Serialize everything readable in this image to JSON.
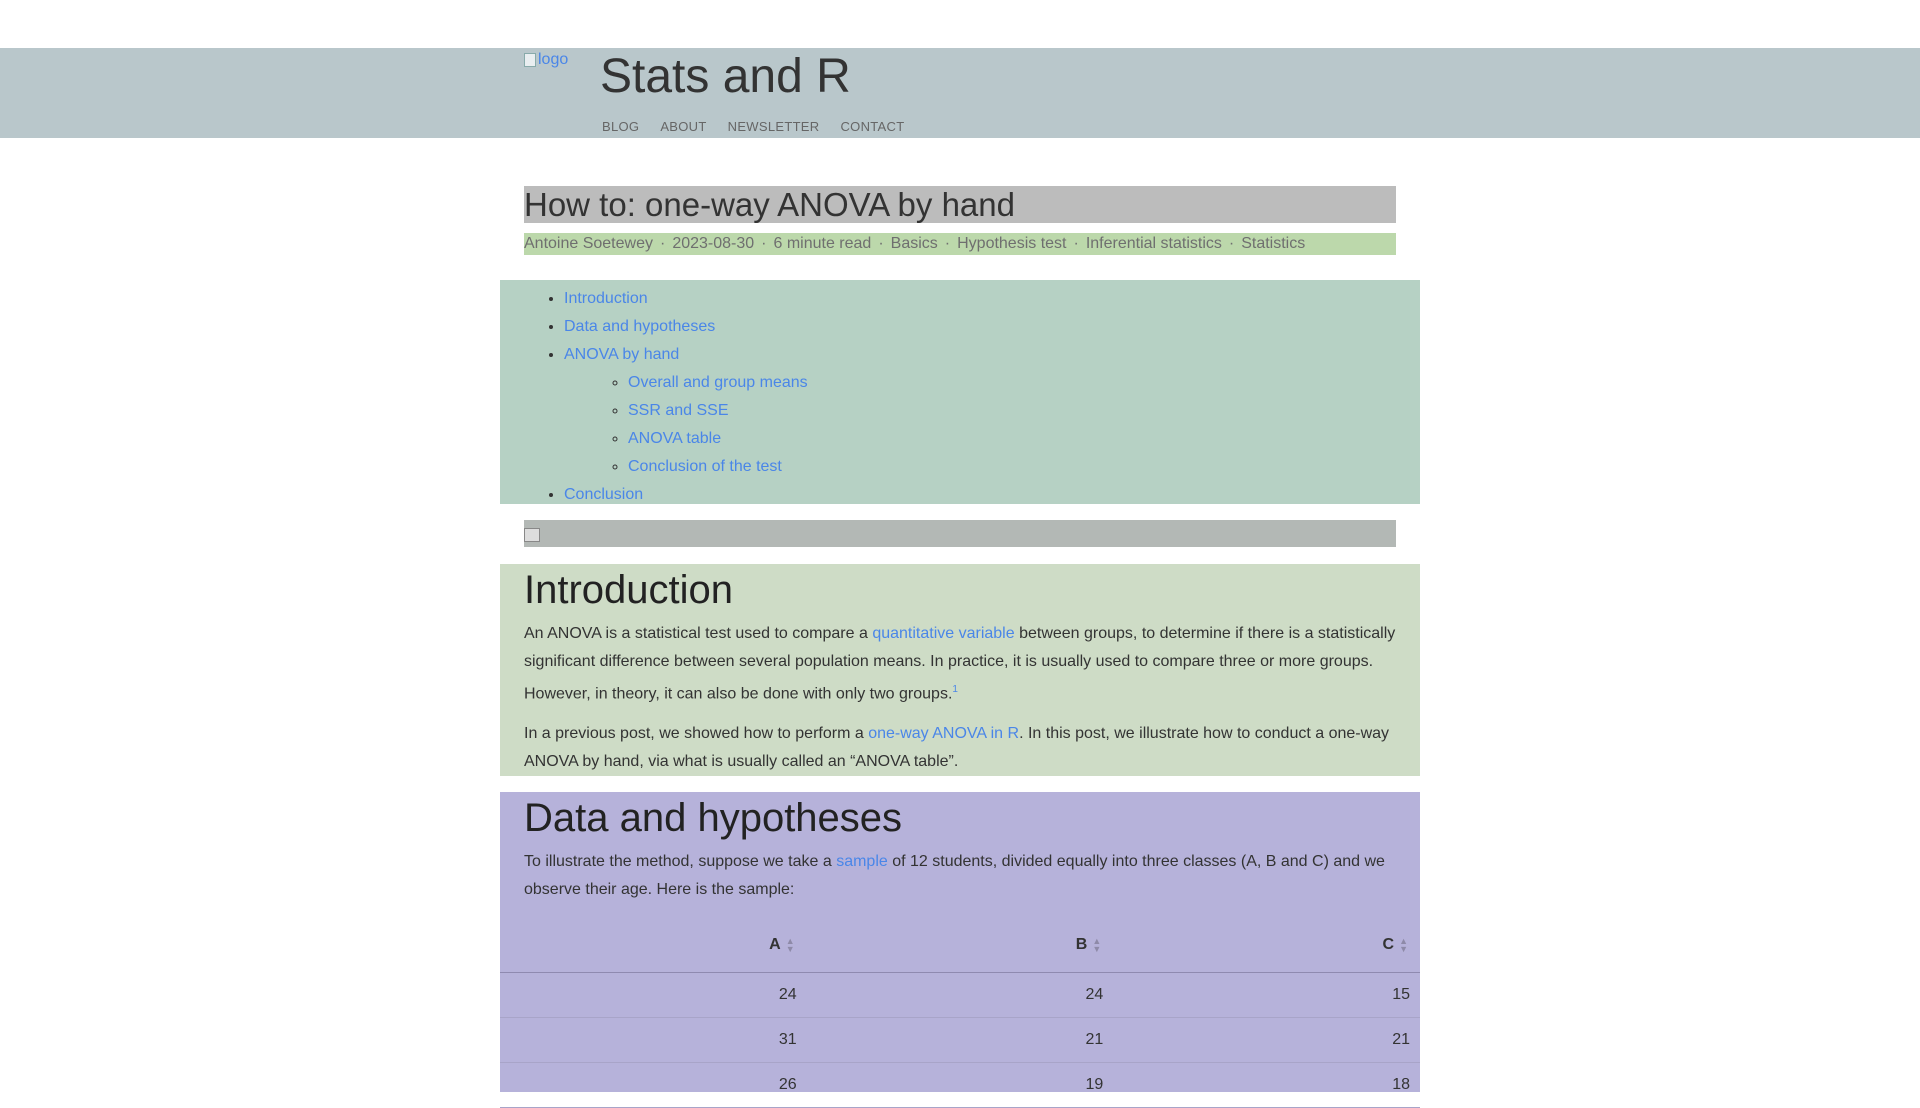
{
  "site": {
    "logo_alt": "logo",
    "title": "Stats and R",
    "nav": [
      "BLOG",
      "ABOUT",
      "NEWSLETTER",
      "CONTACT"
    ]
  },
  "post": {
    "title": "How to: one-way ANOVA by hand",
    "meta": {
      "author": "Antoine Soetewey",
      "date": "2023-08-30",
      "read_time": "6 minute read",
      "tags": [
        "Basics",
        "Hypothesis test",
        "Inferential statistics",
        "Statistics"
      ],
      "separator": "·"
    }
  },
  "toc": {
    "items": [
      {
        "label": "Introduction"
      },
      {
        "label": "Data and hypotheses"
      },
      {
        "label": "ANOVA by hand",
        "children": [
          "Overall and group means",
          "SSR and SSE",
          "ANOVA table",
          "Conclusion of the test"
        ]
      },
      {
        "label": "Conclusion"
      }
    ]
  },
  "intro": {
    "heading": "Introduction",
    "p1_before": "An ANOVA is a statistical test used to compare a ",
    "p1_link": "quantitative variable",
    "p1_after": " between groups, to determine if there is a statistically significant difference between several population means. In practice, it is usually used to compare three or more groups. However, in theory, it can also be done with only two groups.",
    "p1_footnote": "1",
    "p2_before": "In a previous post, we showed how to perform a ",
    "p2_link": "one-way ANOVA in R",
    "p2_after": ". In this post, we illustrate how to conduct a one-way ANOVA by hand, via what is usually called an “ANOVA table”."
  },
  "data_section": {
    "heading": "Data and hypotheses",
    "p_before": "To illustrate the method, suppose we take a ",
    "p_link": "sample",
    "p_after": " of 12 students, divided equally into three classes (A, B and C) and we observe their age. Here is the sample:",
    "table": {
      "headers": [
        "A",
        "B",
        "C"
      ],
      "rows": [
        [
          "24",
          "24",
          "15"
        ],
        [
          "31",
          "21",
          "21"
        ],
        [
          "26",
          "19",
          "18"
        ]
      ]
    }
  }
}
